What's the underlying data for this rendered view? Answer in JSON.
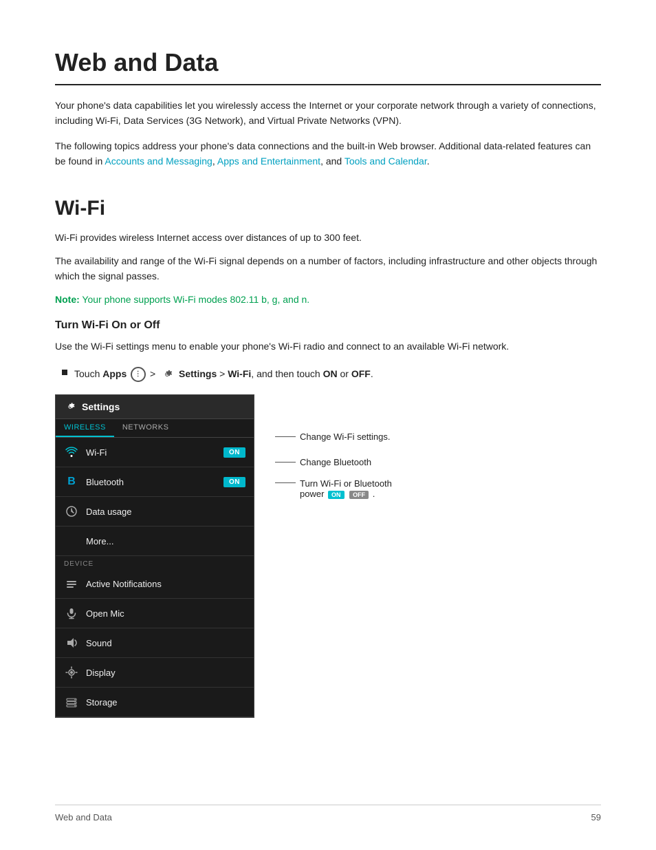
{
  "page": {
    "title": "Web and Data",
    "footer_left": "Web and Data",
    "footer_page": "59"
  },
  "intro": {
    "paragraph1": "Your phone's data capabilities let you wirelessly access the Internet or your corporate network through a variety of connections, including Wi-Fi, Data Services (3G Network), and Virtual Private Networks (VPN).",
    "paragraph2_pre": "The following topics address your phone's data connections and the built-in Web browser. Additional data-related features can be found in ",
    "link1": "Accounts and Messaging",
    "paragraph2_mid": ", ",
    "link2": "Apps and Entertainment",
    "paragraph2_mid2": ", and ",
    "link3": "Tools and Calendar",
    "paragraph2_end": "."
  },
  "wifi_section": {
    "title": "Wi-Fi",
    "para1": "Wi-Fi provides wireless Internet access over distances of up to 300 feet.",
    "para2": "The availability and range of the Wi-Fi signal depends on a number of factors, including infrastructure and other objects through which the signal passes.",
    "note_label": "Note:",
    "note_text": " Your phone supports Wi-Fi modes 802.11 b, g, and n.",
    "subsection_title": "Turn Wi-Fi On or Off",
    "instruction": "Use the Wi-Fi settings menu to enable your phone's Wi-Fi radio and connect to an available Wi-Fi network.",
    "bullet_pre": "Touch ",
    "bullet_apps": "Apps",
    "bullet_apps_icon": "⋮⋮⋮",
    "bullet_mid": " > ",
    "bullet_settings_label": "Settings",
    "bullet_mid2": " > ",
    "bullet_wifi": "Wi-Fi",
    "bullet_mid3": ", and then touch ",
    "bullet_on": "ON",
    "bullet_or": " or ",
    "bullet_off": "OFF",
    "bullet_end": "."
  },
  "screenshot": {
    "header_title": "Settings",
    "tab_wireless": "WIRELESS",
    "tab_networks": "NETWORKS",
    "rows": [
      {
        "icon": "wifi",
        "label": "Wi-Fi",
        "toggle": "ON"
      },
      {
        "icon": "bluetooth",
        "label": "Bluetooth",
        "toggle": "ON"
      },
      {
        "icon": "data",
        "label": "Data usage",
        "toggle": ""
      },
      {
        "icon": "more",
        "label": "More...",
        "toggle": ""
      }
    ],
    "device_label": "DEVICE",
    "device_rows": [
      {
        "icon": "notifications",
        "label": "Active Notifications"
      },
      {
        "icon": "mic",
        "label": "Open Mic"
      },
      {
        "icon": "sound",
        "label": "Sound"
      },
      {
        "icon": "display",
        "label": "Display"
      },
      {
        "icon": "storage",
        "label": "Storage"
      }
    ]
  },
  "annotations": {
    "ann1": "Change Wi-Fi settings.",
    "ann2": "Change Bluetooth",
    "ann3_line1": "Turn Wi-Fi  or Bluetooth",
    "ann3_line2": "power",
    "ann3_on": "ON",
    "ann3_off": "OFF",
    "ann3_end": "."
  }
}
